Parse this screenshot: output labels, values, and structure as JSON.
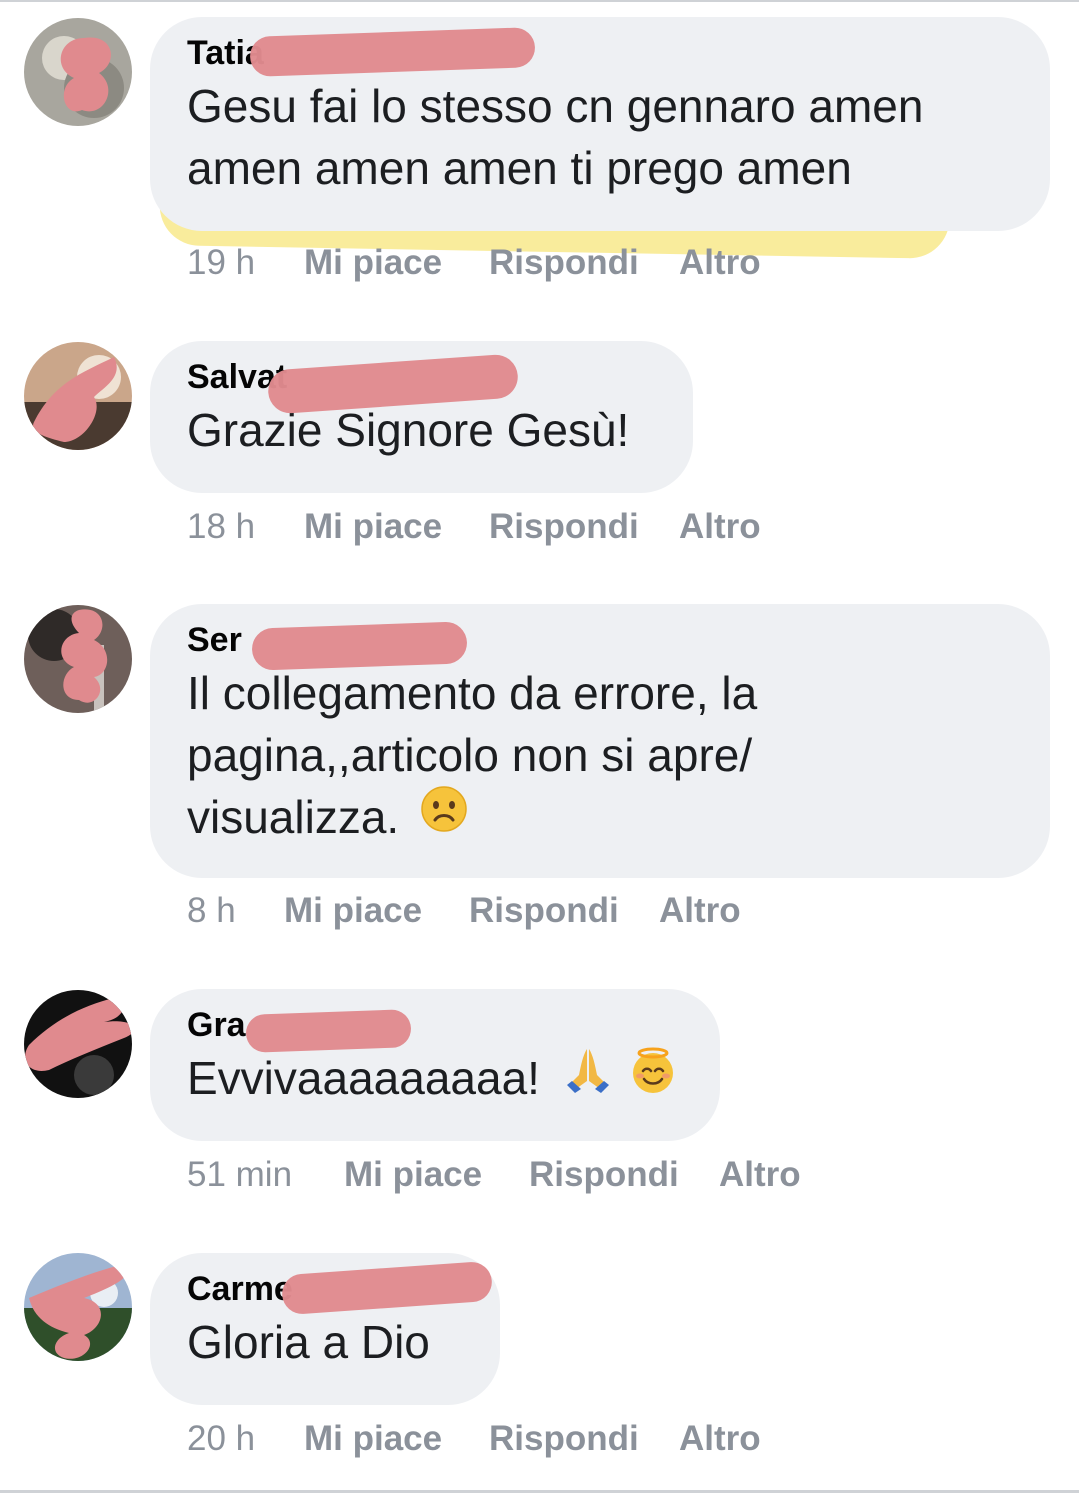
{
  "comments": [
    {
      "name": "Tatia",
      "text": "Gesu fai lo stesso cn gennaro amen amen amen amen ti prego amen",
      "time": "19 h",
      "like": "Mi piace",
      "reply": "Rispondi",
      "more": "Altro"
    },
    {
      "name": "Salvat",
      "text": "Grazie Signore Gesù!",
      "time": "18 h",
      "like": "Mi piace",
      "reply": "Rispondi",
      "more": "Altro"
    },
    {
      "name": "Ser",
      "text": "Il collegamento da errore, la pagina,,articolo non si apre/ visualizza.",
      "time": "8 h",
      "like": "Mi piace",
      "reply": "Rispondi",
      "more": "Altro"
    },
    {
      "name": "Gra",
      "text": "Evvivaaaaaaaaa!",
      "time": "51 min",
      "like": "Mi piace",
      "reply": "Rispondi",
      "more": "Altro"
    },
    {
      "name": "Carme",
      "text": "Gloria a Dio",
      "time": "20 h",
      "like": "Mi piace",
      "reply": "Rispondi",
      "more": "Altro"
    }
  ],
  "colors": {
    "bubble": "#eef0f3",
    "redaction": "#e08a8e",
    "highlight": "#f5e15f",
    "meta_text": "#8b919a"
  },
  "icons": [
    "sad-face-emoji",
    "folded-hands-emoji",
    "smiling-face-with-halo-emoji"
  ]
}
